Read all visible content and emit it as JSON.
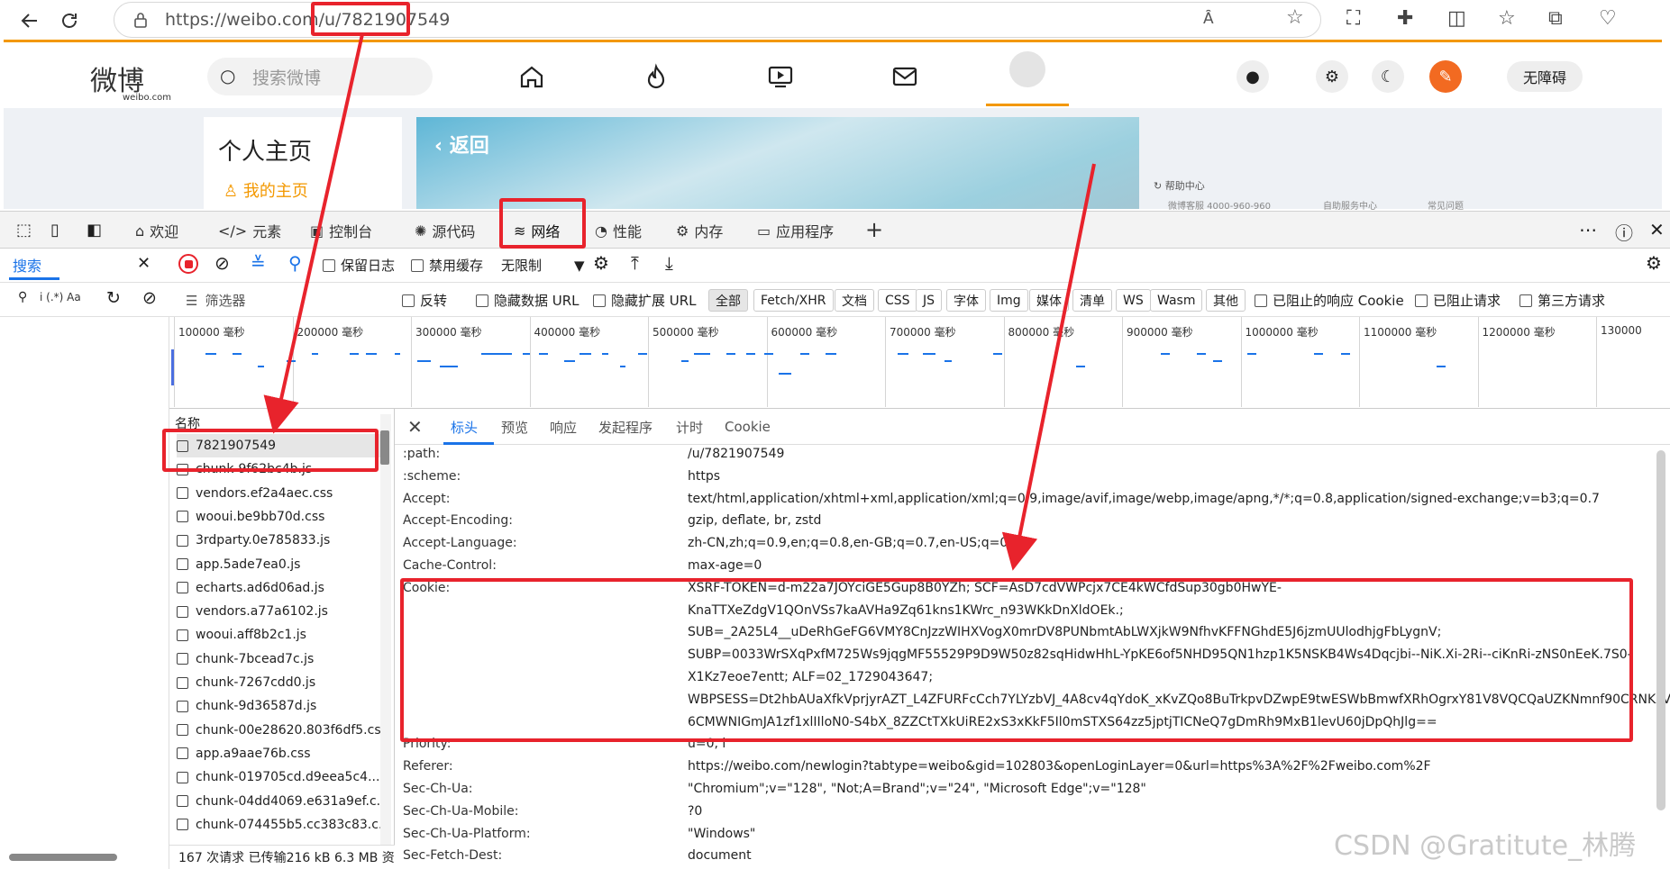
{
  "browser": {
    "url_prefix": "https://weibo.com/u/",
    "url_id": "7821907549"
  },
  "weibo": {
    "logo_text": "微博",
    "logo_sub": "weibo.com",
    "search_placeholder": "搜索微博",
    "accessibility_label": "无障碍",
    "profile_title": "个人主页",
    "my_home": "我的主页",
    "back_label": "返回",
    "help_center": "帮助中心",
    "service_phone": "微博客服 4000-960-960",
    "self_service": "自助服务中心",
    "faq": "常见问题"
  },
  "devtools": {
    "tabs": [
      "欢迎",
      "元素",
      "控制台",
      "源代码",
      "网络",
      "性能",
      "内存",
      "应用程序"
    ],
    "active_tab": "网络",
    "search_tab": "搜索",
    "toolbar": {
      "preserve_log": "保留日志",
      "disable_cache": "禁用缓存",
      "throttle": "无限制"
    },
    "filter_placeholder": "筛选器",
    "filters": {
      "invert": "反转",
      "hide_data_url": "隐藏数据 URL",
      "hide_ext_url": "隐藏扩展 URL",
      "types": [
        "全部",
        "Fetch/XHR",
        "文档",
        "CSS",
        "JS",
        "字体",
        "Img",
        "媒体",
        "清单",
        "WS",
        "Wasm",
        "其他"
      ],
      "blocked_cookie": "已阻止的响应 Cookie",
      "blocked_requests": "已阻止请求",
      "third_party": "第三方请求"
    },
    "timeline_ticks": [
      "100000 毫秒",
      "200000 毫秒",
      "300000 毫秒",
      "400000 毫秒",
      "500000 毫秒",
      "600000 毫秒",
      "700000 毫秒",
      "800000 毫秒",
      "900000 毫秒",
      "1000000 毫秒",
      "1100000 毫秒",
      "1200000 毫秒",
      "130000"
    ],
    "list_header": "名称",
    "requests": [
      "7821907549",
      "chunk-9f62bc4b.js",
      "vendors.ef2a4aec.css",
      "wooui.be9bb70d.css",
      "3rdparty.0e785833.js",
      "app.5ade7ea0.js",
      "echarts.ad6d06ad.js",
      "vendors.a77a6102.js",
      "wooui.aff8b2c1.js",
      "chunk-7bcead7c.js",
      "chunk-7267cdd0.js",
      "chunk-9d36587d.js",
      "chunk-00e28620.803f6df5.css",
      "app.a9aae76b.css",
      "chunk-019705cd.d9eea5c4....",
      "chunk-04dd4069.e631a9ef.c...",
      "chunk-074455b5.cc383c83.c..."
    ],
    "status": "167 次请求  已传输216 kB  6.3 MB 资",
    "detail_tabs": [
      "标头",
      "预览",
      "响应",
      "发起程序",
      "计时",
      "Cookie"
    ],
    "headers": [
      {
        "name": ":path:",
        "value": "/u/7821907549"
      },
      {
        "name": ":scheme:",
        "value": "https"
      },
      {
        "name": "Accept:",
        "value": "text/html,application/xhtml+xml,application/xml;q=0.9,image/avif,image/webp,image/apng,*/*;q=0.8,application/signed-exchange;v=b3;q=0.7"
      },
      {
        "name": "Accept-Encoding:",
        "value": "gzip, deflate, br, zstd"
      },
      {
        "name": "Accept-Language:",
        "value": "zh-CN,zh;q=0.9,en;q=0.8,en-GB;q=0.7,en-US;q=0.6"
      },
      {
        "name": "Cache-Control:",
        "value": "max-age=0"
      }
    ],
    "cookie_name": "Cookie:",
    "cookie_lines": [
      "XSRF-TOKEN=d-m22a7JOYciGE5Gup8B0YZh; SCF=AsD7cdVWPcjx7CE4kWCfdSup30gb0HwYE-",
      "KnaTTXeZdgV1QOnVSs7kaAVHa9Zq61kns1KWrc_n93WKkDnXldOEk.;",
      "SUB=_2A25L4__uDeRhGeFG6VMY8CnJzzWIHXVogX0mrDV8PUNbmtAbLWXjkW9NfhvKFFNGhdE5J6jzmUUlodhjgFbLygnV;",
      "SUBP=0033WrSXqPxfM725Ws9jqgMF55529P9D9W50z82sqHidwHhL-YpKE6of5NHD95QN1hzp1K5NSKB4Ws4Dqcjbi--NiK.Xi-2Ri--ciKnRi-zNS0nEeK.7S0-",
      "X1Kz7eoe7entt; ALF=02_1729043647;",
      "WBPSESS=Dt2hbAUaXfkVprjyrAZT_L4ZFURFcCch7YLYzbVJ_4A8cv4qYdoK_xKvZQo8BuTrkpvDZwpE9twESWbBmwfXRhOgrxY81V8VQCQaUZKNmnf90CRNKzVP-",
      "6CMWNIGmJA1zf1xlIIloN0-S4bX_8ZZCtTXkUiRE2xS3xKkF5Il0mSTXS64zz5jptjTICNeQ7gDmRh9MxB1levU60jDpQhJlg=="
    ],
    "headers_after": [
      {
        "name": "Priority:",
        "value": "u=0, i"
      },
      {
        "name": "Referer:",
        "value": "https://weibo.com/newlogin?tabtype=weibo&gid=102803&openLoginLayer=0&url=https%3A%2F%2Fweibo.com%2F"
      },
      {
        "name": "Sec-Ch-Ua:",
        "value": "\"Chromium\";v=\"128\", \"Not;A=Brand\";v=\"24\", \"Microsoft Edge\";v=\"128\""
      },
      {
        "name": "Sec-Ch-Ua-Mobile:",
        "value": "?0"
      },
      {
        "name": "Sec-Ch-Ua-Platform:",
        "value": "\"Windows\""
      },
      {
        "name": "Sec-Fetch-Dest:",
        "value": "document"
      }
    ]
  },
  "watermark": "CSDN @Gratitute_林腾",
  "colors": {
    "annotation": "#e8232c",
    "weibo_orange": "#f39800",
    "link_blue": "#1a73e8"
  }
}
